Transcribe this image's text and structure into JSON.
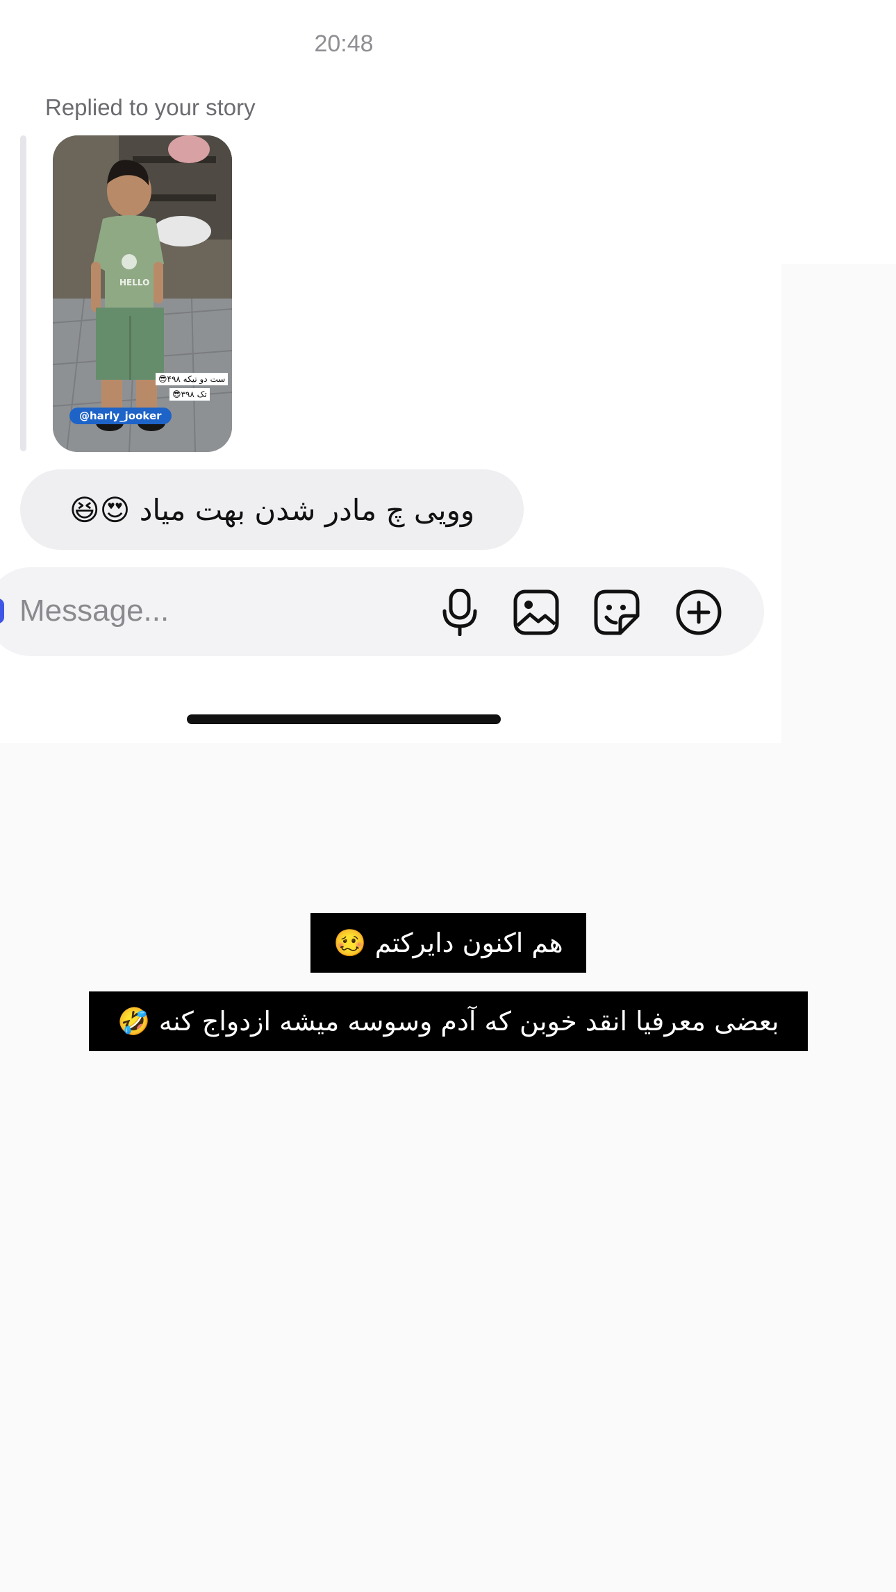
{
  "thread": {
    "timestamp": "20:48",
    "reply_label": "Replied to your story",
    "story": {
      "tag": "@harly_jooker",
      "price_line_1": "ست دو تیکه ۴۹۸😎",
      "price_line_2": "تک ۳۹۸😎"
    },
    "message": {
      "text": "وویی چ مادر شدن بهت میاد 😍😆"
    }
  },
  "composer": {
    "placeholder": "Message...",
    "icons": [
      "microphone-icon",
      "gallery-icon",
      "sticker-icon",
      "plus-circle-icon"
    ]
  },
  "overlay": {
    "caption_1": "هم اکنون دایرکتم 🥴",
    "caption_2": "بعضی معرفیا انقد خوبن که آدم وسوسه میشه ازدواج کنه 🤣"
  },
  "colors": {
    "background": "#fafafa",
    "bubble": "#efeff2",
    "composer": "#f3f3f5",
    "caption_bg": "#000000",
    "caption_text": "#ffffff",
    "story_tag": "#1d63c8"
  }
}
